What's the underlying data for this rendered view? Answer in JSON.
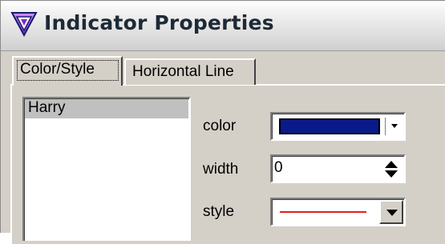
{
  "window": {
    "title": "Indicator Properties",
    "icon": "indicator-app-icon"
  },
  "tabs": [
    {
      "label": "Color/Style",
      "active": true
    },
    {
      "label": "Horizontal Line",
      "active": false
    }
  ],
  "list": {
    "items": [
      "Harry"
    ],
    "selected": "Harry"
  },
  "properties": {
    "color": {
      "label": "color",
      "value": "#0a1a8a"
    },
    "width": {
      "label": "width",
      "value": "0"
    },
    "style": {
      "label": "style",
      "line_color": "#e02020"
    }
  },
  "icons": {
    "dropdown": "chevron-down-icon",
    "spin_up": "spin-up-icon",
    "spin_down": "spin-down-icon"
  }
}
